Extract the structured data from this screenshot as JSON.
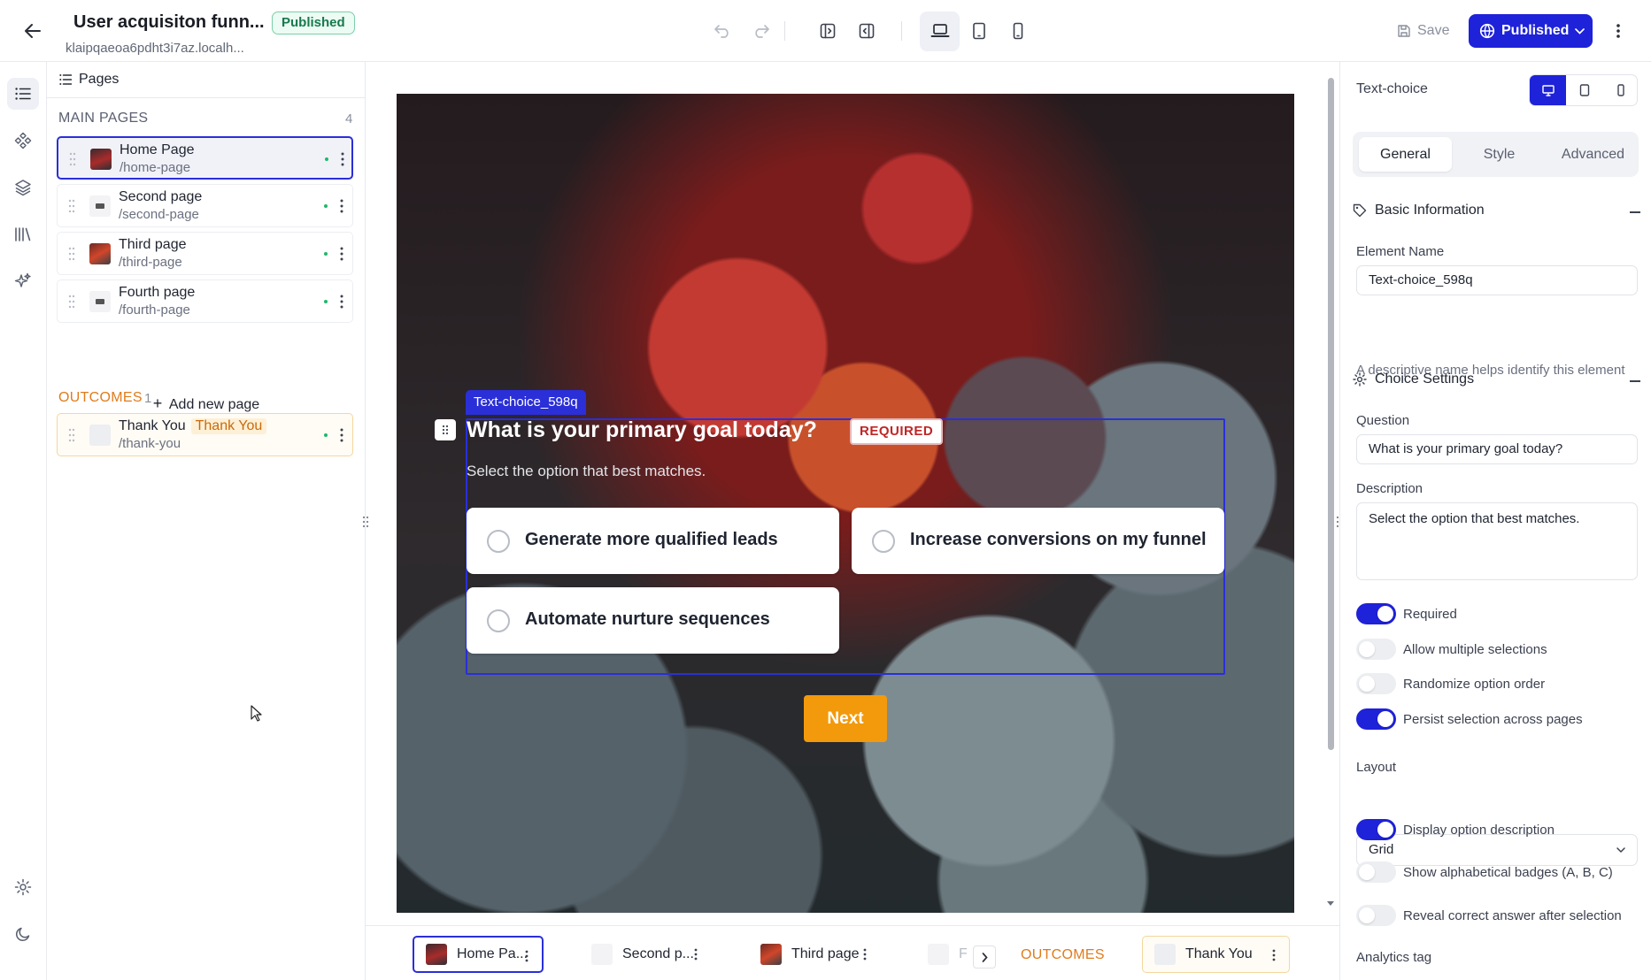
{
  "header": {
    "title": "User acquisiton funn...",
    "status_badge": "Published",
    "subdomain": "klaipqaeoa6pdht3i7az.localh...",
    "save_label": "Save",
    "publish_label": "Published"
  },
  "rail": {
    "items": [
      "pages-icon",
      "components-icon",
      "layers-icon",
      "library-icon",
      "ai-sparkle-icon",
      "settings-icon",
      "moon-icon"
    ]
  },
  "pages_panel": {
    "header": "Pages",
    "main_label": "MAIN PAGES",
    "main_count": "4",
    "pages": [
      {
        "name": "Home Page",
        "path": "/home-page"
      },
      {
        "name": "Second page",
        "path": "/second-page"
      },
      {
        "name": "Third page",
        "path": "/third-page"
      },
      {
        "name": "Fourth page",
        "path": "/fourth-page"
      }
    ],
    "add_page": "Add new page",
    "outcomes_label": "OUTCOMES",
    "outcomes_count": "1",
    "outcomes": [
      {
        "name": "Thank You",
        "tag": "Thank You",
        "path": "/thank-you"
      }
    ]
  },
  "canvas": {
    "element_label": "Text-choice_598q",
    "question": "What is your primary goal today?",
    "required_badge": "REQUIRED",
    "description": "Select the option that best matches.",
    "options": [
      "Generate more qualified leads",
      "Increase conversions on my funnel",
      "Automate nurture sequences"
    ],
    "next_label": "Next"
  },
  "bottom_tabs": {
    "pages": [
      "Home Pa...",
      "Second p...",
      "Third page",
      "F"
    ],
    "outcomes_label": "OUTCOMES",
    "outcome_tab": "Thank You"
  },
  "right_panel": {
    "element_type": "Text-choice",
    "tabs": [
      "General",
      "Style",
      "Advanced"
    ],
    "active_tab": "General",
    "basic_info_title": "Basic Information",
    "element_name_label": "Element Name",
    "element_name_value": "Text-choice_598q",
    "element_name_help": "A descriptive name helps identify this element",
    "choice_settings_title": "Choice Settings",
    "question_label": "Question",
    "question_value": "What is your primary goal today?",
    "description_label": "Description",
    "description_value": "Select the option that best matches.",
    "toggles": [
      {
        "label": "Required",
        "on": true
      },
      {
        "label": "Allow multiple selections",
        "on": false
      },
      {
        "label": "Randomize option order",
        "on": false
      },
      {
        "label": "Persist selection across pages",
        "on": true
      }
    ],
    "layout_label": "Layout",
    "layout_value": "Grid",
    "toggles2": [
      {
        "label": "Display option description",
        "on": true
      },
      {
        "label": "Show alphabetical badges (A, B, C)",
        "on": false
      },
      {
        "label": "Reveal correct answer after selection",
        "on": false
      }
    ],
    "analytics_label": "Analytics tag"
  },
  "colors": {
    "primary": "#1e22d8",
    "next_button": "#f29a0c",
    "outcome_accent": "#e07b1b",
    "published_green": "#177a4d"
  }
}
